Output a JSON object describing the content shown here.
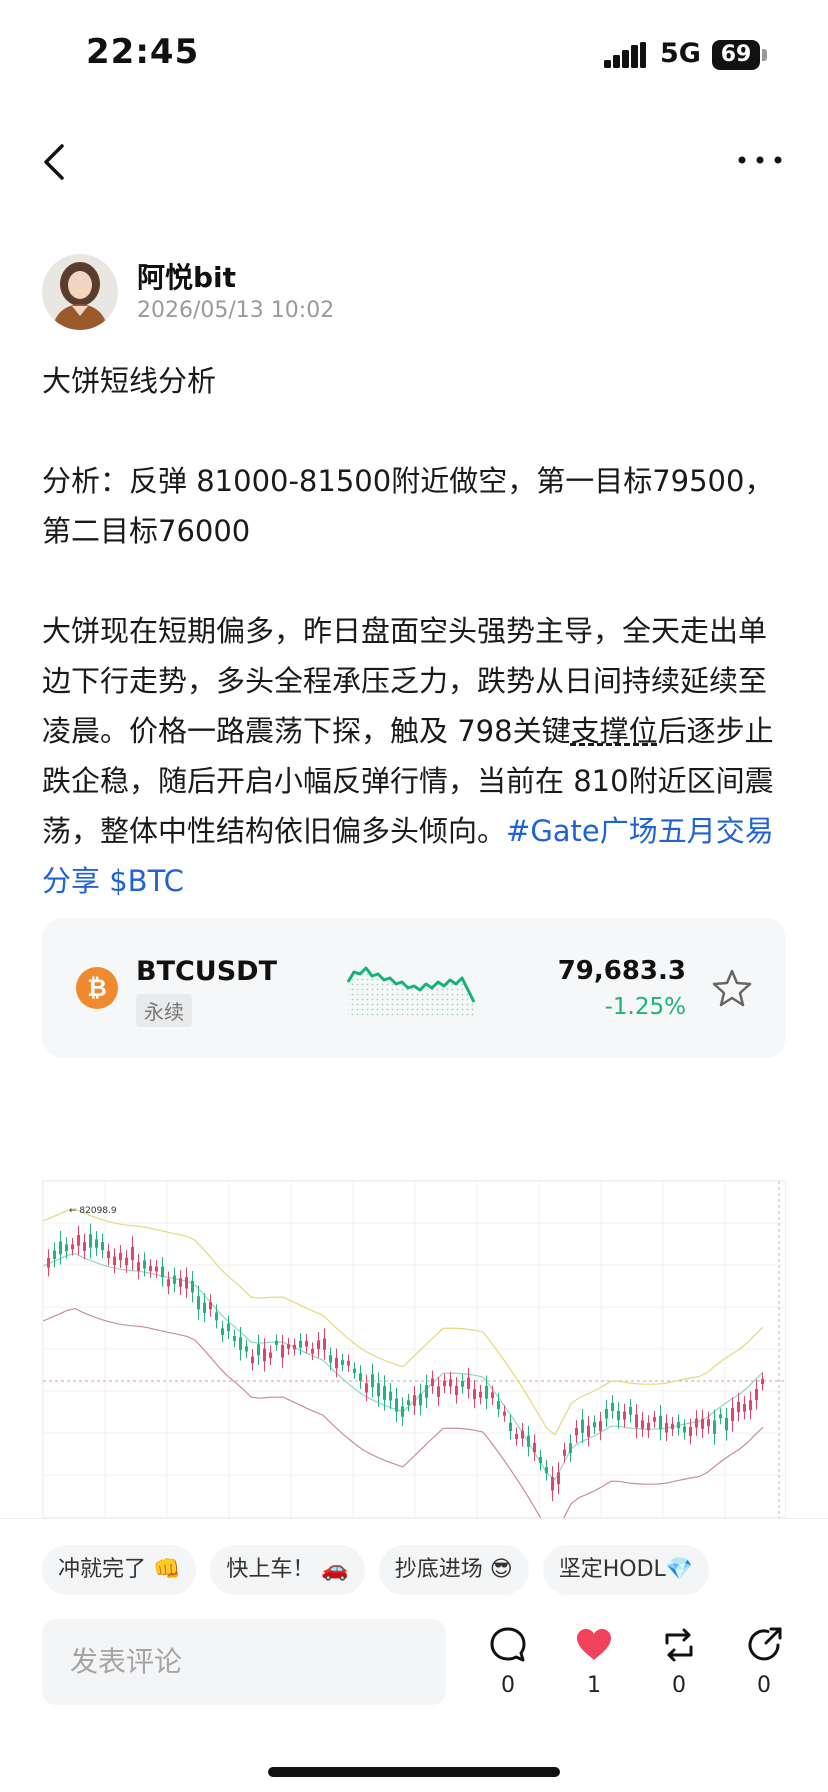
{
  "status_bar": {
    "time": "22:45",
    "network": "5G",
    "battery": "69"
  },
  "nav": {
    "back_icon": "back-chevron-icon",
    "more_icon": "more-dots-icon"
  },
  "author": {
    "name": "阿悦bit",
    "timestamp": "2026/05/13 10:02"
  },
  "post": {
    "title": "大饼短线分析",
    "analysis": "分析：反弹 81000-81500附近做空，第一目标79500，第二目标76000",
    "body_before_underline": "大饼现在短期偏多，昨日盘面空头强势主导，全天走出单边下行走势，多头全程承压乏力，跌势从日间持续延续至凌晨。价格一路震荡下探，触及 798关键",
    "body_underlined": "支撑位",
    "body_after_underline": "后逐步止跌企稳，随后开启小幅反弹行情，当前在 810附近区间震荡，整体中性结构依旧偏多头倾向。",
    "hashtag": "#Gate广场五月交易分享",
    "cashtag": "$BTC"
  },
  "ticker": {
    "symbol": "BTCUSDT",
    "tag": "永续",
    "price": "79,683.3",
    "change": "-1.25%",
    "coin_icon": "bitcoin-icon",
    "up_color": "#1bb27b"
  },
  "chart_image": {
    "high_label": "82098.9"
  },
  "quick_replies": [
    "冲就完了 👊",
    "快上车！ 🚗",
    "抄底进场 😎",
    "坚定HODL💎"
  ],
  "comment": {
    "placeholder": "发表评论"
  },
  "actions": {
    "comments": "0",
    "likes": "1",
    "reposts": "0",
    "shares": "0",
    "like_color": "#f0425c"
  }
}
